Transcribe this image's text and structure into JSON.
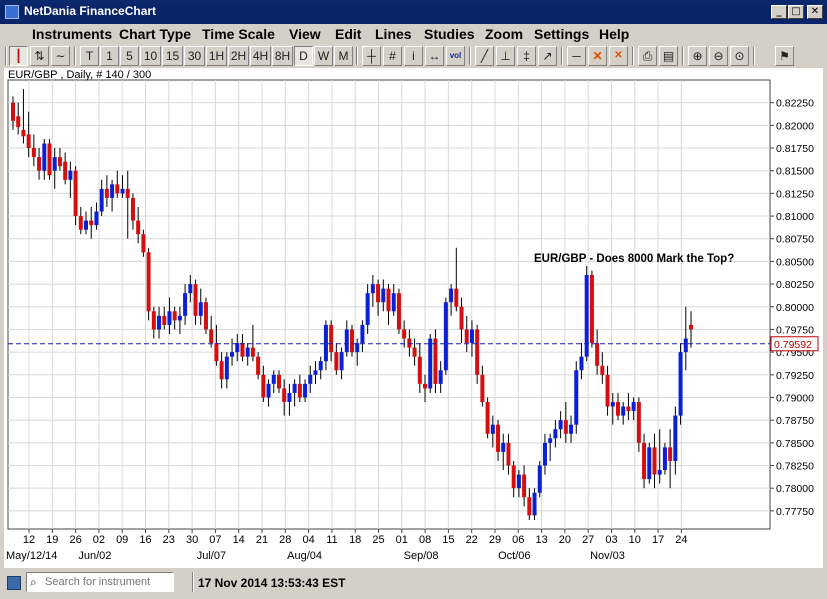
{
  "window": {
    "title": "NetDania FinanceChart"
  },
  "menu": [
    "Instruments",
    "Chart Type",
    "Time Scale",
    "View",
    "Edit",
    "Lines",
    "Studies",
    "Zoom",
    "Settings",
    "Help"
  ],
  "toolbar": {
    "chart_types": [
      {
        "name": "candlestick-chart-icon",
        "glyph": "┃",
        "active": true
      },
      {
        "name": "ohlc-chart-icon",
        "glyph": "⇅",
        "active": false
      },
      {
        "name": "line-chart-icon",
        "glyph": "∼",
        "active": false
      }
    ],
    "timeframes": [
      "T",
      "1",
      "5",
      "10",
      "15",
      "30",
      "1H",
      "2H",
      "4H",
      "8H",
      "D",
      "W",
      "M"
    ],
    "active_timeframe": "D",
    "tools": [
      {
        "name": "crosshair-icon",
        "glyph": "┼"
      },
      {
        "name": "grid-icon",
        "glyph": "#"
      },
      {
        "name": "info-icon",
        "glyph": "i"
      },
      {
        "name": "scroll-arrows-icon",
        "glyph": "↔"
      },
      {
        "name": "volume-icon",
        "glyph": "vol"
      },
      {
        "name": "trendline-icon",
        "glyph": "╱"
      },
      {
        "name": "fibonacci-icon",
        "glyph": "⊥"
      },
      {
        "name": "channel-icon",
        "glyph": "‡"
      },
      {
        "name": "arrow-line-icon",
        "glyph": "↗"
      },
      {
        "name": "horizontal-line-icon",
        "glyph": "─"
      },
      {
        "name": "delete-drawing-icon",
        "glyph": "✕"
      },
      {
        "name": "delete-all-icon",
        "glyph": "✕"
      },
      {
        "name": "print-icon",
        "glyph": "⎙"
      },
      {
        "name": "print-preview-icon",
        "glyph": "▤"
      },
      {
        "name": "zoom-in-icon",
        "glyph": "⊕"
      },
      {
        "name": "zoom-out-icon",
        "glyph": "⊖"
      },
      {
        "name": "zoom-reset-icon",
        "glyph": "⊙"
      },
      {
        "name": "pin-icon",
        "glyph": "⚑"
      }
    ]
  },
  "chart_info": "EUR/GBP , Daily, # 140 / 300",
  "statusbar": {
    "search_placeholder": "Search for instrument",
    "datetime": "17 Nov 2014 13:53:43 EST"
  },
  "colors": {
    "up": "#0a1fd6",
    "down": "#d40f0f",
    "grid": "#d8d8d8",
    "current_line": "#1a1aa8",
    "current_label": "#c00000"
  },
  "chart_data": {
    "type": "candlestick",
    "symbol": "EUR/GBP",
    "interval": "Daily",
    "title": "EUR/GBP - Does 8000 Mark the Top?",
    "ylim": [
      0.7755,
      0.825
    ],
    "yticks": [
      0.7775,
      0.78,
      0.7825,
      0.785,
      0.7875,
      0.79,
      0.7925,
      0.795,
      0.7975,
      0.8,
      0.8025,
      0.805,
      0.8075,
      0.81,
      0.8125,
      0.815,
      0.8175,
      0.82,
      0.8225
    ],
    "current_price": 0.79592,
    "current_price_label": "0.79592",
    "x_tick_labels": [
      "12",
      "19",
      "26",
      "02",
      "09",
      "16",
      "23",
      "30",
      "07",
      "14",
      "21",
      "28",
      "04",
      "11",
      "18",
      "25",
      "01",
      "08",
      "15",
      "22",
      "29",
      "06",
      "13",
      "20",
      "27",
      "03",
      "10",
      "17",
      "24"
    ],
    "month_labels": [
      {
        "label": "May/12/14",
        "tick": 0
      },
      {
        "label": "Jun/02",
        "tick": 3
      },
      {
        "label": "Jul/07",
        "tick": 8
      },
      {
        "label": "Aug/04",
        "tick": 12
      },
      {
        "label": "Sep/08",
        "tick": 17
      },
      {
        "label": "Oct/06",
        "tick": 21
      },
      {
        "label": "Nov/03",
        "tick": 25
      }
    ],
    "candles": [
      [
        0.8225,
        0.8232,
        0.8195,
        0.8205
      ],
      [
        0.821,
        0.8225,
        0.819,
        0.8198
      ],
      [
        0.8195,
        0.824,
        0.818,
        0.8188
      ],
      [
        0.819,
        0.8215,
        0.8165,
        0.8175
      ],
      [
        0.8175,
        0.819,
        0.8155,
        0.8165
      ],
      [
        0.8165,
        0.8175,
        0.814,
        0.815
      ],
      [
        0.815,
        0.8185,
        0.814,
        0.818
      ],
      [
        0.818,
        0.8185,
        0.814,
        0.8145
      ],
      [
        0.815,
        0.8175,
        0.813,
        0.8165
      ],
      [
        0.8165,
        0.8175,
        0.815,
        0.8155
      ],
      [
        0.816,
        0.817,
        0.8135,
        0.814
      ],
      [
        0.814,
        0.816,
        0.812,
        0.815
      ],
      [
        0.815,
        0.8155,
        0.809,
        0.81
      ],
      [
        0.81,
        0.811,
        0.808,
        0.8085
      ],
      [
        0.8085,
        0.8105,
        0.808,
        0.8095
      ],
      [
        0.8095,
        0.811,
        0.8075,
        0.809
      ],
      [
        0.809,
        0.8115,
        0.8085,
        0.8105
      ],
      [
        0.8105,
        0.814,
        0.81,
        0.813
      ],
      [
        0.813,
        0.8145,
        0.811,
        0.812
      ],
      [
        0.812,
        0.814,
        0.8105,
        0.8135
      ],
      [
        0.8135,
        0.815,
        0.812,
        0.8125
      ],
      [
        0.8125,
        0.8145,
        0.812,
        0.813
      ],
      [
        0.813,
        0.815,
        0.8075,
        0.812
      ],
      [
        0.812,
        0.8125,
        0.8085,
        0.8095
      ],
      [
        0.8095,
        0.811,
        0.807,
        0.808
      ],
      [
        0.808,
        0.8085,
        0.8055,
        0.806
      ],
      [
        0.806,
        0.8065,
        0.7985,
        0.7995
      ],
      [
        0.7995,
        0.8,
        0.7965,
        0.7975
      ],
      [
        0.7975,
        0.8,
        0.7965,
        0.799
      ],
      [
        0.799,
        0.8,
        0.7975,
        0.798
      ],
      [
        0.798,
        0.801,
        0.797,
        0.7995
      ],
      [
        0.7995,
        0.8,
        0.7975,
        0.7985
      ],
      [
        0.7985,
        0.8,
        0.797,
        0.799
      ],
      [
        0.799,
        0.8025,
        0.798,
        0.8015
      ],
      [
        0.8015,
        0.8035,
        0.8005,
        0.8025
      ],
      [
        0.8025,
        0.803,
        0.798,
        0.799
      ],
      [
        0.799,
        0.802,
        0.798,
        0.8005
      ],
      [
        0.8005,
        0.801,
        0.797,
        0.7975
      ],
      [
        0.7975,
        0.799,
        0.7955,
        0.796
      ],
      [
        0.796,
        0.798,
        0.7935,
        0.794
      ],
      [
        0.794,
        0.795,
        0.791,
        0.792
      ],
      [
        0.792,
        0.795,
        0.791,
        0.7945
      ],
      [
        0.7945,
        0.7965,
        0.7935,
        0.795
      ],
      [
        0.795,
        0.797,
        0.794,
        0.796
      ],
      [
        0.796,
        0.797,
        0.794,
        0.7945
      ],
      [
        0.7945,
        0.796,
        0.7935,
        0.7955
      ],
      [
        0.7955,
        0.798,
        0.794,
        0.7945
      ],
      [
        0.7945,
        0.795,
        0.792,
        0.7925
      ],
      [
        0.7925,
        0.7935,
        0.7895,
        0.79
      ],
      [
        0.79,
        0.792,
        0.789,
        0.7915
      ],
      [
        0.7915,
        0.793,
        0.7905,
        0.7925
      ],
      [
        0.7925,
        0.793,
        0.7905,
        0.791
      ],
      [
        0.791,
        0.792,
        0.788,
        0.7895
      ],
      [
        0.7895,
        0.7915,
        0.788,
        0.7905
      ],
      [
        0.7905,
        0.792,
        0.789,
        0.7915
      ],
      [
        0.7915,
        0.7925,
        0.7895,
        0.79
      ],
      [
        0.79,
        0.792,
        0.7895,
        0.7915
      ],
      [
        0.7915,
        0.7935,
        0.7905,
        0.7925
      ],
      [
        0.7925,
        0.794,
        0.7915,
        0.793
      ],
      [
        0.793,
        0.7945,
        0.792,
        0.794
      ],
      [
        0.794,
        0.7985,
        0.793,
        0.798
      ],
      [
        0.798,
        0.7985,
        0.794,
        0.795
      ],
      [
        0.795,
        0.796,
        0.7925,
        0.793
      ],
      [
        0.793,
        0.7955,
        0.792,
        0.795
      ],
      [
        0.795,
        0.7985,
        0.7945,
        0.7975
      ],
      [
        0.7975,
        0.798,
        0.7945,
        0.795
      ],
      [
        0.795,
        0.7965,
        0.7935,
        0.796
      ],
      [
        0.796,
        0.7985,
        0.795,
        0.798
      ],
      [
        0.798,
        0.8025,
        0.797,
        0.8015
      ],
      [
        0.8015,
        0.8035,
        0.8,
        0.8025
      ],
      [
        0.8025,
        0.803,
        0.799,
        0.8005
      ],
      [
        0.8005,
        0.803,
        0.7995,
        0.802
      ],
      [
        0.802,
        0.8025,
        0.798,
        0.7995
      ],
      [
        0.7995,
        0.8025,
        0.799,
        0.8015
      ],
      [
        0.8015,
        0.802,
        0.797,
        0.7975
      ],
      [
        0.7975,
        0.7985,
        0.7955,
        0.7965
      ],
      [
        0.7965,
        0.7975,
        0.7945,
        0.7955
      ],
      [
        0.7955,
        0.7965,
        0.7935,
        0.7945
      ],
      [
        0.7945,
        0.796,
        0.7905,
        0.7915
      ],
      [
        0.7915,
        0.7925,
        0.7895,
        0.791
      ],
      [
        0.791,
        0.797,
        0.7905,
        0.7965
      ],
      [
        0.7965,
        0.7975,
        0.7905,
        0.7915
      ],
      [
        0.7915,
        0.794,
        0.7905,
        0.793
      ],
      [
        0.793,
        0.801,
        0.7925,
        0.8005
      ],
      [
        0.8005,
        0.8025,
        0.799,
        0.802
      ],
      [
        0.802,
        0.8065,
        0.7995,
        0.8
      ],
      [
        0.8,
        0.801,
        0.796,
        0.7975
      ],
      [
        0.7975,
        0.799,
        0.795,
        0.796
      ],
      [
        0.796,
        0.7985,
        0.7945,
        0.7975
      ],
      [
        0.7975,
        0.798,
        0.7915,
        0.7925
      ],
      [
        0.7925,
        0.7935,
        0.789,
        0.7895
      ],
      [
        0.7895,
        0.79,
        0.7855,
        0.786
      ],
      [
        0.786,
        0.788,
        0.7845,
        0.787
      ],
      [
        0.787,
        0.7875,
        0.783,
        0.784
      ],
      [
        0.784,
        0.786,
        0.782,
        0.785
      ],
      [
        0.785,
        0.786,
        0.7815,
        0.7825
      ],
      [
        0.7825,
        0.783,
        0.779,
        0.78
      ],
      [
        0.78,
        0.782,
        0.779,
        0.7815
      ],
      [
        0.7815,
        0.7825,
        0.778,
        0.779
      ],
      [
        0.779,
        0.78,
        0.7765,
        0.777
      ],
      [
        0.777,
        0.78,
        0.7765,
        0.7795
      ],
      [
        0.7795,
        0.783,
        0.779,
        0.7825
      ],
      [
        0.7825,
        0.786,
        0.7815,
        0.785
      ],
      [
        0.785,
        0.786,
        0.783,
        0.7855
      ],
      [
        0.7855,
        0.7875,
        0.7845,
        0.7865
      ],
      [
        0.7865,
        0.7885,
        0.7855,
        0.7875
      ],
      [
        0.7875,
        0.7895,
        0.785,
        0.786
      ],
      [
        0.786,
        0.788,
        0.785,
        0.787
      ],
      [
        0.787,
        0.794,
        0.786,
        0.793
      ],
      [
        0.793,
        0.796,
        0.792,
        0.7945
      ],
      [
        0.7945,
        0.8045,
        0.794,
        0.8035
      ],
      [
        0.8035,
        0.804,
        0.7955,
        0.796
      ],
      [
        0.796,
        0.7975,
        0.7925,
        0.7935
      ],
      [
        0.7935,
        0.795,
        0.7915,
        0.7925
      ],
      [
        0.7925,
        0.7935,
        0.788,
        0.789
      ],
      [
        0.789,
        0.7905,
        0.787,
        0.7895
      ],
      [
        0.7895,
        0.7905,
        0.7875,
        0.788
      ],
      [
        0.788,
        0.7895,
        0.787,
        0.789
      ],
      [
        0.789,
        0.7905,
        0.7875,
        0.7885
      ],
      [
        0.7885,
        0.79,
        0.7875,
        0.7895
      ],
      [
        0.7895,
        0.79,
        0.784,
        0.785
      ],
      [
        0.785,
        0.786,
        0.78,
        0.781
      ],
      [
        0.781,
        0.785,
        0.7805,
        0.7845
      ],
      [
        0.7845,
        0.786,
        0.78,
        0.7815
      ],
      [
        0.7815,
        0.7865,
        0.7805,
        0.782
      ],
      [
        0.782,
        0.785,
        0.7815,
        0.7845
      ],
      [
        0.7845,
        0.7865,
        0.78,
        0.783
      ],
      [
        0.783,
        0.789,
        0.7815,
        0.788
      ],
      [
        0.788,
        0.796,
        0.787,
        0.795
      ],
      [
        0.795,
        0.8,
        0.793,
        0.7965
      ],
      [
        0.798,
        0.7995,
        0.7955,
        0.7975
      ]
    ]
  }
}
